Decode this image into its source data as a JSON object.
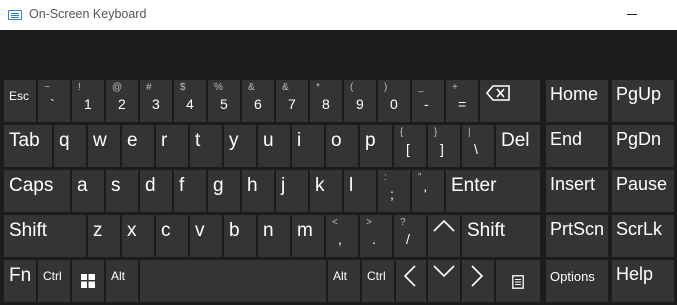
{
  "window": {
    "title": "On-Screen Keyboard"
  },
  "icons": {
    "app": "keyboard-icon",
    "minimize": "minimize-icon",
    "backspace": "backspace-icon",
    "windows": "windows-logo-icon",
    "left": "left-arrow-icon",
    "up": "up-arrow-icon",
    "down": "down-arrow-icon",
    "right": "right-arrow-icon",
    "menu": "context-menu-icon"
  },
  "colors": {
    "background": "#1c1c1c",
    "key": "#343434",
    "text": "#ffffff",
    "secondary_text": "#bdbdbd"
  },
  "keys": {
    "row1": [
      {
        "top": "",
        "main": "Esc"
      },
      {
        "top": "~",
        "main": "`"
      },
      {
        "top": "!",
        "main": "1"
      },
      {
        "top": "@",
        "main": "2"
      },
      {
        "top": "#",
        "main": "3"
      },
      {
        "top": "$",
        "main": "4"
      },
      {
        "top": "%",
        "main": "5"
      },
      {
        "top": "&",
        "main": "6"
      },
      {
        "top": "&",
        "main": "7"
      },
      {
        "top": "*",
        "main": "8"
      },
      {
        "top": "(",
        "main": "9"
      },
      {
        "top": ")",
        "main": "0"
      },
      {
        "top": "_",
        "main": "-"
      },
      {
        "top": "+",
        "main": "="
      }
    ],
    "row2": [
      {
        "main": "Tab"
      },
      {
        "main": "q"
      },
      {
        "main": "w"
      },
      {
        "main": "e"
      },
      {
        "main": "r"
      },
      {
        "main": "t"
      },
      {
        "main": "y"
      },
      {
        "main": "u"
      },
      {
        "main": "i"
      },
      {
        "main": "o"
      },
      {
        "main": "p"
      },
      {
        "top": "{",
        "main": "["
      },
      {
        "top": "}",
        "main": "]"
      },
      {
        "top": "|",
        "main": "\\"
      },
      {
        "main": "Del"
      }
    ],
    "row3": [
      {
        "main": "Caps"
      },
      {
        "main": "a"
      },
      {
        "main": "s"
      },
      {
        "main": "d"
      },
      {
        "main": "f"
      },
      {
        "main": "g"
      },
      {
        "main": "h"
      },
      {
        "main": "j"
      },
      {
        "main": "k"
      },
      {
        "main": "l"
      },
      {
        "top": ":",
        "main": ";"
      },
      {
        "top": "\"",
        "main": "'"
      },
      {
        "main": "Enter"
      }
    ],
    "row4": [
      {
        "main": "Shift"
      },
      {
        "main": "z"
      },
      {
        "main": "x"
      },
      {
        "main": "c"
      },
      {
        "main": "v"
      },
      {
        "main": "b"
      },
      {
        "main": "n"
      },
      {
        "main": "m"
      },
      {
        "top": "<",
        "main": ","
      },
      {
        "top": ">",
        "main": "."
      },
      {
        "top": "?",
        "main": "/"
      },
      {
        "main": "Shift"
      }
    ],
    "row5": {
      "fn": "Fn",
      "ctrl": "Ctrl",
      "alt": "Alt",
      "alt_r": "Alt",
      "ctrl_r": "Ctrl"
    },
    "nav": {
      "home": "Home",
      "pgup": "PgUp",
      "end": "End",
      "pgdn": "PgDn",
      "insert": "Insert",
      "pause": "Pause",
      "prtscn": "PrtScn",
      "scrlk": "ScrLk",
      "options": "Options",
      "help": "Help"
    }
  }
}
